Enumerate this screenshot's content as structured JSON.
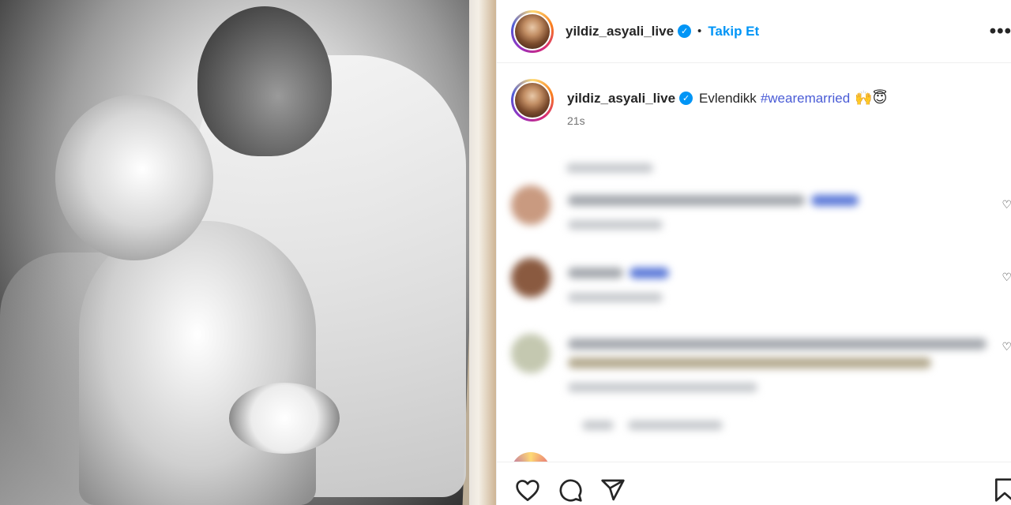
{
  "post": {
    "author": {
      "username": "yildiz_asyali_live",
      "verified": true,
      "verified_mark": "✓"
    },
    "header": {
      "separator": "•",
      "follow_label": "Takip Et",
      "more_label": "•••"
    },
    "caption": {
      "text": "Evlendikk",
      "hashtag": "#wearemarried",
      "emojis": "🙌😇",
      "time": "21s"
    }
  },
  "icons": {
    "like": "heart-icon",
    "comment": "comment-icon",
    "share": "send-icon",
    "save": "bookmark-icon",
    "comment_like": "small-heart-icon",
    "comment_like_glyph": "♡"
  },
  "colors": {
    "accent": "#0095f6",
    "hashtag": "#4a5cd6",
    "text": "#262626",
    "muted": "#737373",
    "divider": "#efefef"
  }
}
